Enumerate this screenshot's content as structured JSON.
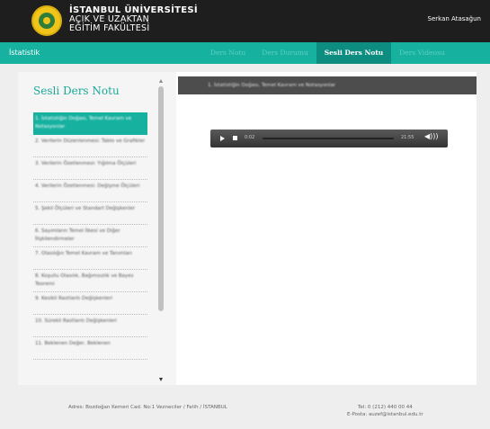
{
  "header": {
    "university_line1": "İSTANBUL ÜNİVERSİTESİ",
    "university_line2": "AÇIK VE UZAKTAN",
    "university_line3": "EĞİTİM FAKÜLTESİ",
    "username": "Serkan Atasağun"
  },
  "nav": {
    "left_label": "İstatistik",
    "tabs": [
      {
        "label": "Ders Notu"
      },
      {
        "label": "Ders Durumu"
      },
      {
        "label": "Sesli Ders Notu",
        "active": true
      },
      {
        "label": "Ders Videosu"
      }
    ]
  },
  "sidebar": {
    "title": "Sesli Ders Notu",
    "items": [
      {
        "label": "1. İstatistiğin Doğası, Temel Kavram ve Notasyonlar",
        "active": true
      },
      {
        "label": "2. Verilerin Düzenlenmesi: Tablo ve Grafikler"
      },
      {
        "label": "3. Verilerin Özetlenmesi: Yığılma Ölçüleri"
      },
      {
        "label": "4. Verilerin Özetlenmesi: Değişme Ölçüleri"
      },
      {
        "label": "5. Şekil Ölçüleri ve Standart Değişkenler"
      },
      {
        "label": "6. Sayımların Temel İlkesi ve Diğer İlişkilendirmeler"
      },
      {
        "label": "7. Olasılığın Temel Kavram ve Tanımları"
      },
      {
        "label": "8. Koşullu Olasılık, Bağımsızlık ve Bayes Teoremi"
      },
      {
        "label": "9. Kesikli Rastlantı Değişkenleri"
      },
      {
        "label": "10. Sürekli Rastlantı Değişkenleri"
      },
      {
        "label": "11. Beklenen Değer, Beklenen"
      }
    ]
  },
  "content": {
    "header_title": "1. İstatistiğin Doğası, Temel Kavram ve Notasyonlar"
  },
  "player": {
    "current_time": "0:02",
    "total_time": "21:55",
    "progress": 0.0015
  },
  "footer": {
    "address": "Adres: Bozdoğan Kemeri Cad. No:1 Vezneciler / Fatih / İSTANBUL",
    "phone": "Tel: 0 (212) 440 00 44",
    "email": "E-Posta: auzef@istanbul.edu.tr"
  }
}
